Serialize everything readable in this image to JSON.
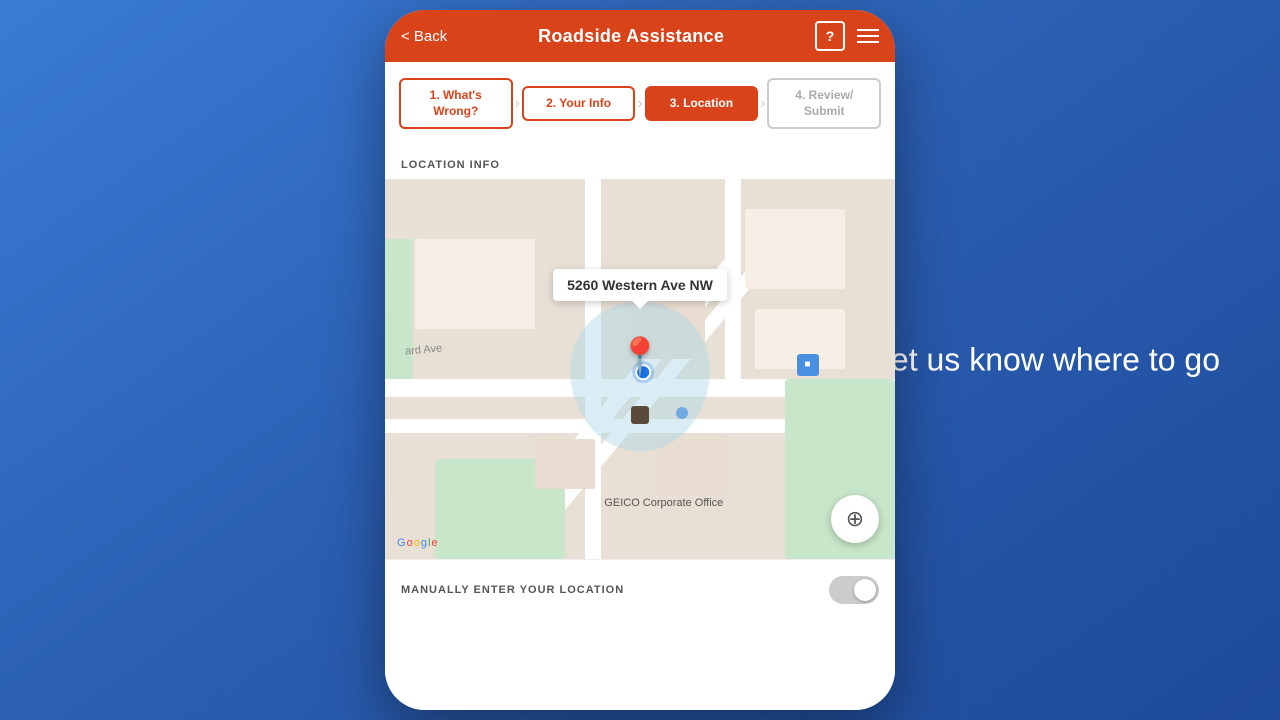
{
  "background": {
    "color": "#2f6fc9"
  },
  "right_text": "Let us know where to go",
  "header": {
    "back_label": "< Back",
    "title": "Roadside Assistance",
    "help_icon": "?",
    "menu_icon": "hamburger"
  },
  "steps": [
    {
      "id": "step1",
      "label": "1. What's Wrong?",
      "state": "inactive"
    },
    {
      "id": "step2",
      "label": "2. Your Info",
      "state": "inactive"
    },
    {
      "id": "step3",
      "label": "3. Location",
      "state": "active"
    },
    {
      "id": "step4",
      "label": "4. Review/ Submit",
      "state": "disabled"
    }
  ],
  "location_section": {
    "label": "LOCATION INFO",
    "address": "5260 Western Ave NW",
    "geico_label": "GEICO Corporate Office",
    "google_label": "Google",
    "location_btn_icon": "⊕"
  },
  "manual_location": {
    "label": "MANUALLY ENTER YOUR LOCATION",
    "toggle_state": false
  }
}
